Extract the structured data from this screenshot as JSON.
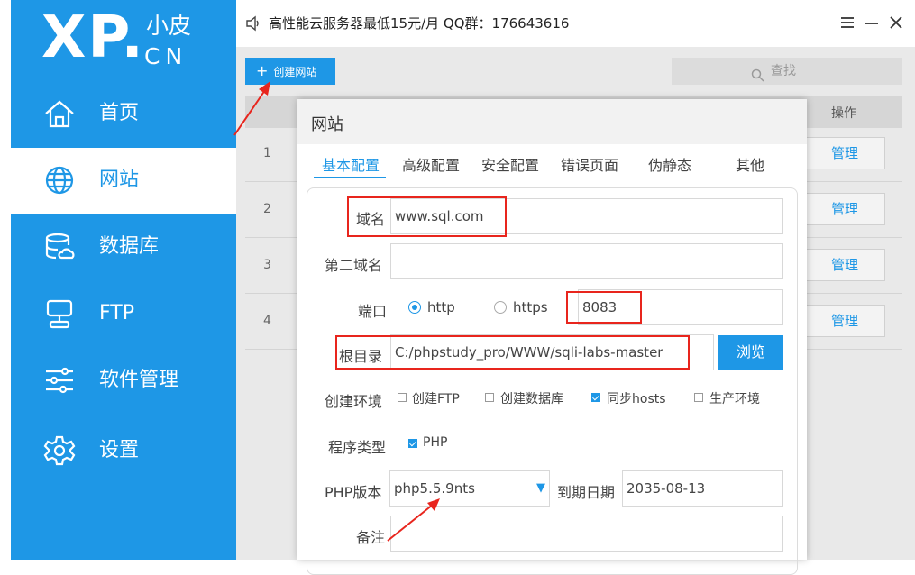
{
  "logo": {
    "mark": "XP.",
    "sub_top": "小皮",
    "sub_bottom": "CN"
  },
  "sidebar": {
    "items": [
      {
        "label": "首页",
        "icon": "home-icon"
      },
      {
        "label": "网站",
        "icon": "globe-icon",
        "active": true
      },
      {
        "label": "数据库",
        "icon": "database-icon"
      },
      {
        "label": "FTP",
        "icon": "ftp-server-icon"
      },
      {
        "label": "软件管理",
        "icon": "sliders-icon"
      },
      {
        "label": "设置",
        "icon": "gear-icon"
      }
    ]
  },
  "titlebar": {
    "notice": "高性能云服务器最低15元/月 QQ群：176643616"
  },
  "toolbar": {
    "create_label": "创建网站",
    "search_label": "查找"
  },
  "table": {
    "op_header": "操作",
    "rows": [
      {
        "num": "1",
        "action": "管理"
      },
      {
        "num": "2",
        "action": "管理"
      },
      {
        "num": "3",
        "action": "管理"
      },
      {
        "num": "4",
        "action": "管理"
      }
    ]
  },
  "dialog": {
    "title": "网站",
    "tabs": [
      "基本配置",
      "高级配置",
      "安全配置",
      "错误页面",
      "伪静态",
      "其他"
    ],
    "form": {
      "domain_label": "域名",
      "domain_value": "www.sql.com",
      "second_domain_label": "第二域名",
      "second_domain_value": "",
      "port_label": "端口",
      "http_label": "http",
      "https_label": "https",
      "port_value": "8083",
      "root_label": "根目录",
      "root_value": "C:/phpstudy_pro/WWW/sqli-labs-master",
      "browse_label": "浏览",
      "env_label": "创建环境",
      "env_options": [
        {
          "label": "创建FTP",
          "checked": false
        },
        {
          "label": "创建数据库",
          "checked": false
        },
        {
          "label": "同步hosts",
          "checked": true
        },
        {
          "label": "生产环境",
          "checked": false
        }
      ],
      "program_label": "程序类型",
      "program_option": "PHP",
      "php_label": "PHP版本",
      "php_value": "php5.5.9nts",
      "expire_label": "到期日期",
      "expire_value": "2035-08-13",
      "remark_label": "备注",
      "remark_value": ""
    }
  },
  "colors": {
    "accent": "#1e97e6",
    "annotation": "#e8251d"
  }
}
